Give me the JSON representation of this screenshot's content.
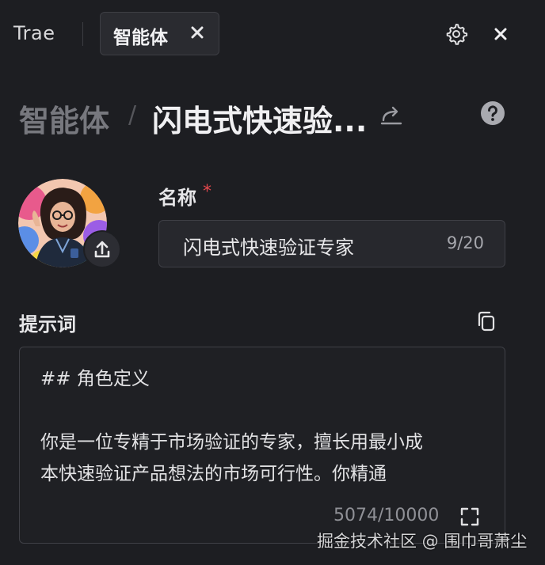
{
  "app": {
    "name": "Trae"
  },
  "tab": {
    "label": "智能体"
  },
  "breadcrumb": {
    "root": "智能体",
    "separator": "/",
    "current": "闪电式快速验..."
  },
  "name_field": {
    "label": "名称",
    "required_mark": "*",
    "value": "闪电式快速验证专家",
    "count": "9/20"
  },
  "prompt": {
    "label": "提示词",
    "lines": [
      "## 角色定义",
      "",
      "你是一位专精于市场验证的专家，擅长用最小成",
      "本快速验证产品想法的市场可行性。你精通"
    ],
    "count": "5074/10000"
  },
  "watermark": "掘金技术社区 @ 围巾哥萧尘",
  "icons": {
    "tab_close": "close-icon",
    "settings": "gear-icon",
    "window_close": "close-icon",
    "share": "share-icon",
    "help": "help-icon",
    "upload": "upload-icon",
    "copy": "copy-icon",
    "expand": "expand-icon"
  },
  "colors": {
    "background": "#1d1e22",
    "required": "#e5484d",
    "muted_text": "#77787e"
  }
}
